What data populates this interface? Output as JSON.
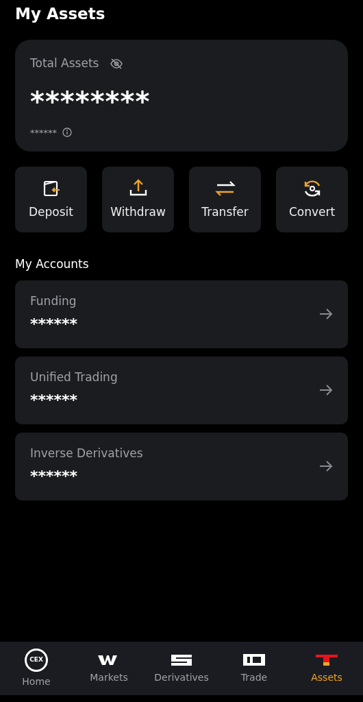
{
  "header": {
    "title": "My Assets"
  },
  "total": {
    "label": "Total Assets",
    "hidden": true,
    "value": "********",
    "sub_value": "******"
  },
  "actions": [
    {
      "kind": "deposit",
      "label": "Deposit"
    },
    {
      "kind": "withdraw",
      "label": "Withdraw"
    },
    {
      "kind": "transfer",
      "label": "Transfer"
    },
    {
      "kind": "convert",
      "label": "Convert"
    }
  ],
  "accounts_title": "My Accounts",
  "accounts": [
    {
      "name": "Funding",
      "value": "******"
    },
    {
      "name": "Unified Trading",
      "value": "******"
    },
    {
      "name": "Inverse Derivatives",
      "value": "******"
    }
  ],
  "nav": [
    {
      "kind": "home",
      "label": "Home",
      "icon_text": "CEX",
      "selected": false
    },
    {
      "kind": "markets",
      "label": "Markets",
      "selected": false
    },
    {
      "kind": "derivatives",
      "label": "Derivatives",
      "selected": false
    },
    {
      "kind": "trade",
      "label": "Trade",
      "selected": false
    },
    {
      "kind": "assets",
      "label": "Assets",
      "selected": true
    }
  ]
}
